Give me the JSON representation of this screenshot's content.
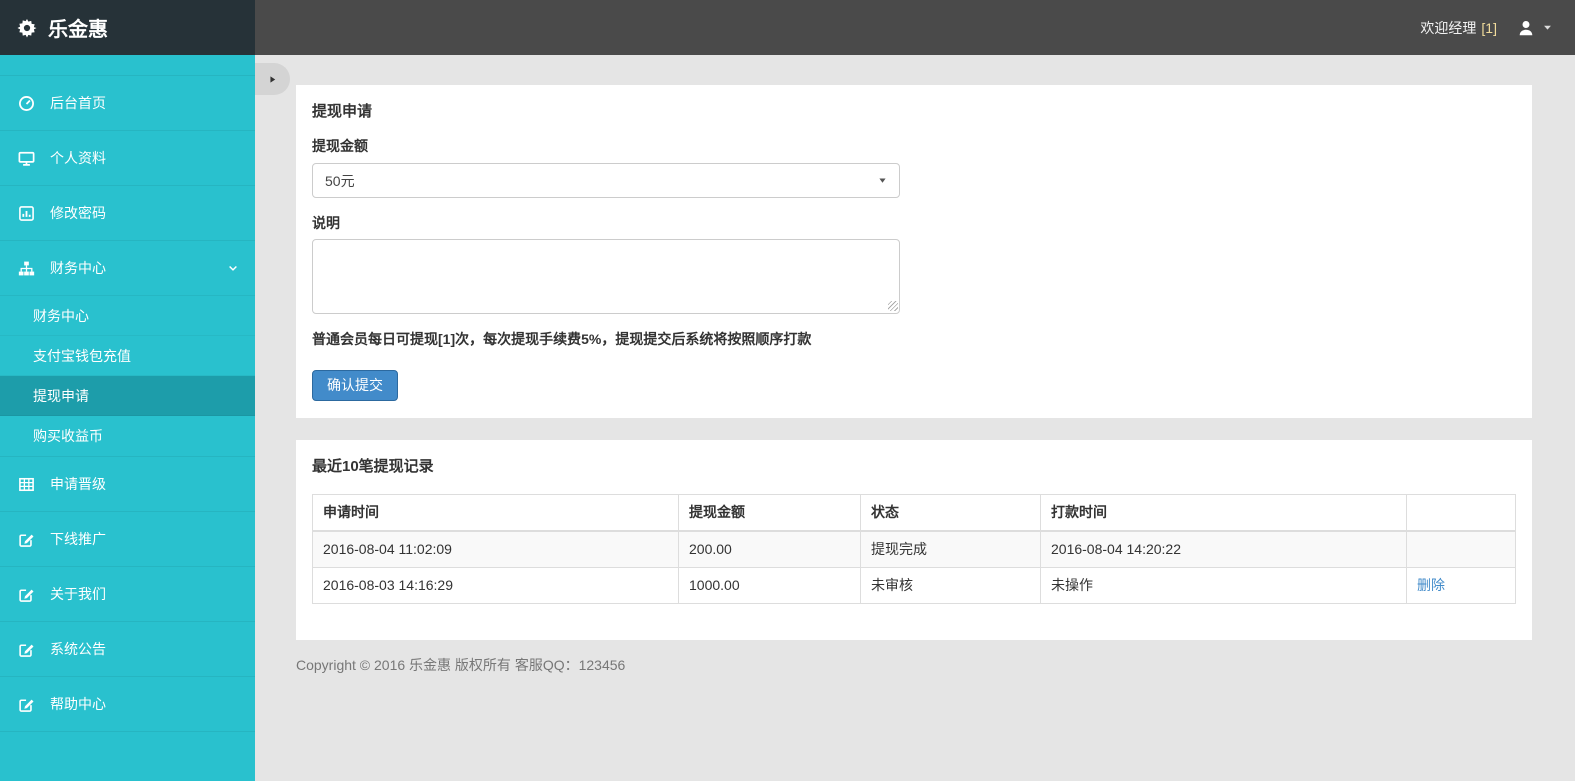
{
  "brand": {
    "title": "乐金惠"
  },
  "topbar": {
    "welcome": "欢迎经理",
    "badge": "[1]"
  },
  "sidebar": {
    "items": [
      {
        "label": "后台首页",
        "icon": "dashboard-icon"
      },
      {
        "label": "个人资料",
        "icon": "desktop-icon"
      },
      {
        "label": "修改密码",
        "icon": "bar-chart-icon"
      },
      {
        "label": "财务中心",
        "icon": "sitemap-icon",
        "expanded": true
      },
      {
        "label": "申请晋级",
        "icon": "table-icon"
      },
      {
        "label": "下线推广",
        "icon": "edit-icon"
      },
      {
        "label": "关于我们",
        "icon": "edit-icon"
      },
      {
        "label": "系统公告",
        "icon": "edit-icon"
      },
      {
        "label": "帮助中心",
        "icon": "edit-icon"
      }
    ],
    "finance_submenu": [
      {
        "label": "财务中心",
        "active": false
      },
      {
        "label": "支付宝钱包充值",
        "active": false
      },
      {
        "label": "提现申请",
        "active": true
      },
      {
        "label": "购买收益币",
        "active": false
      }
    ]
  },
  "withdraw_form": {
    "title": "提现申请",
    "amount_label": "提现金额",
    "amount_value": "50元",
    "note_label": "说明",
    "note_value": "",
    "tip": "普通会员每日可提现[1]次，每次提现手续费5%，提现提交后系统将按照顺序打款",
    "submit_label": "确认提交"
  },
  "records": {
    "title": "最近10笔提现记录",
    "headers": [
      "申请时间",
      "提现金额",
      "状态",
      "打款时间",
      ""
    ],
    "rows": [
      {
        "apply_time": "2016-08-04 11:02:09",
        "amount": "200.00",
        "status": "提现完成",
        "pay_time": "2016-08-04 14:20:22",
        "action": ""
      },
      {
        "apply_time": "2016-08-03 14:16:29",
        "amount": "1000.00",
        "status": "未审核",
        "pay_time": "未操作",
        "action": "删除"
      }
    ]
  },
  "footer": {
    "copyright": "Copyright © 2016 乐金惠 版权所有 客服QQ：123456"
  },
  "colors": {
    "sidebar_teal": "#29c1ce",
    "sidebar_active": "#1d9daa",
    "brand_bg": "#263238",
    "topbar_bg": "#4a4a4a",
    "accent_blue": "#428bca",
    "badge_yellow": "#f1dc9c",
    "content_bg": "#e5e5e5"
  }
}
